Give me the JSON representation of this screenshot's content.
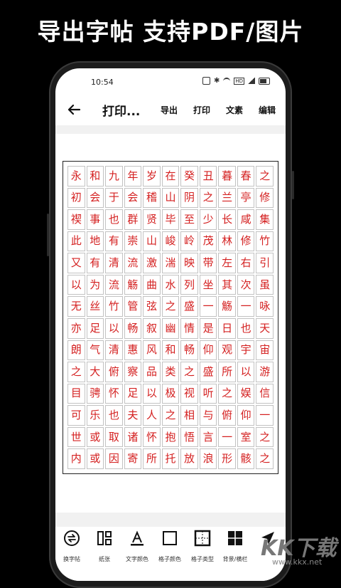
{
  "banner": {
    "headline": "导出字帖 支持PDF/图片"
  },
  "status_bar": {
    "time": "10:54"
  },
  "toolbar": {
    "title": "打印...",
    "export_label": "导出",
    "print_label": "打印",
    "text_label": "文素",
    "edit_label": "编辑"
  },
  "copybook": {
    "rows": [
      [
        "永",
        "和",
        "九",
        "年",
        "岁",
        "在",
        "癸",
        "丑",
        "暮",
        "春",
        "之"
      ],
      [
        "初",
        "会",
        "于",
        "会",
        "稽",
        "山",
        "阴",
        "之",
        "兰",
        "亭",
        "修"
      ],
      [
        "禊",
        "事",
        "也",
        "群",
        "贤",
        "毕",
        "至",
        "少",
        "长",
        "咸",
        "集"
      ],
      [
        "此",
        "地",
        "有",
        "崇",
        "山",
        "峻",
        "岭",
        "茂",
        "林",
        "修",
        "竹"
      ],
      [
        "又",
        "有",
        "清",
        "流",
        "激",
        "湍",
        "映",
        "带",
        "左",
        "右",
        "引"
      ],
      [
        "以",
        "为",
        "流",
        "觞",
        "曲",
        "水",
        "列",
        "坐",
        "其",
        "次",
        "虽"
      ],
      [
        "无",
        "丝",
        "竹",
        "管",
        "弦",
        "之",
        "盛",
        "一",
        "觞",
        "一",
        "咏"
      ],
      [
        "亦",
        "足",
        "以",
        "畅",
        "叙",
        "幽",
        "情",
        "是",
        "日",
        "也",
        "天"
      ],
      [
        "朗",
        "气",
        "清",
        "惠",
        "风",
        "和",
        "畅",
        "仰",
        "观",
        "宇",
        "宙"
      ],
      [
        "之",
        "大",
        "俯",
        "察",
        "品",
        "类",
        "之",
        "盛",
        "所",
        "以",
        "游"
      ],
      [
        "目",
        "骋",
        "怀",
        "足",
        "以",
        "极",
        "视",
        "听",
        "之",
        "娱",
        "信"
      ],
      [
        "可",
        "乐",
        "也",
        "夫",
        "人",
        "之",
        "相",
        "与",
        "俯",
        "仰",
        "一"
      ],
      [
        "世",
        "或",
        "取",
        "诸",
        "怀",
        "抱",
        "悟",
        "言",
        "一",
        "室",
        "之"
      ],
      [
        "内",
        "或",
        "因",
        "寄",
        "所",
        "托",
        "放",
        "浪",
        "形",
        "骸",
        "之"
      ]
    ],
    "char_color": "#d42020",
    "cell_border_color": "#c2c2c2"
  },
  "bottom_bar": {
    "items": [
      {
        "label": "换字帖",
        "icon": "swap-icon"
      },
      {
        "label": "纸张",
        "icon": "paper-layout-icon"
      },
      {
        "label": "文字颜色",
        "icon": "text-color-icon"
      },
      {
        "label": "格子颜色",
        "icon": "grid-color-icon"
      },
      {
        "label": "格子类型",
        "icon": "grid-type-icon"
      },
      {
        "label": "背景/横栏",
        "icon": "background-icon"
      },
      {
        "label": "",
        "icon": "send-icon"
      }
    ]
  },
  "watermark": {
    "logo": "KK下载",
    "url": "www.kkx.net"
  }
}
